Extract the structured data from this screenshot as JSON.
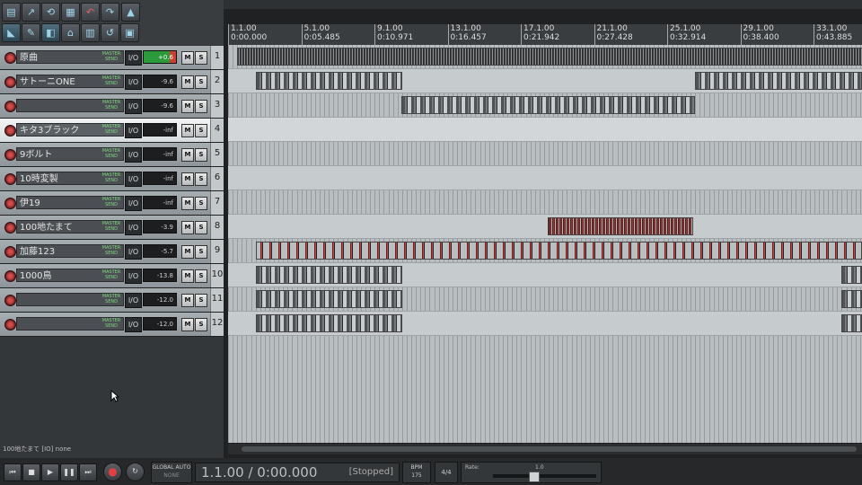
{
  "ruler": {
    "markers": [
      {
        "bar": "1.1.00",
        "time": "0:00.000"
      },
      {
        "bar": "5.1.00",
        "time": "0:05.485"
      },
      {
        "bar": "9.1.00",
        "time": "0:10.971"
      },
      {
        "bar": "13.1.00",
        "time": "0:16.457"
      },
      {
        "bar": "17.1.00",
        "time": "0:21.942"
      },
      {
        "bar": "21.1.00",
        "time": "0:27.428"
      },
      {
        "bar": "25.1.00",
        "time": "0:32.914"
      },
      {
        "bar": "29.1.00",
        "time": "0:38.400"
      },
      {
        "bar": "33.1.00",
        "time": "0:43.885"
      }
    ]
  },
  "tracks": [
    {
      "num": "1",
      "name": "原曲",
      "volume": "+0.6",
      "io": "I/O",
      "m": "M",
      "s": "S",
      "send": "MASTER SEND"
    },
    {
      "num": "2",
      "name": "サトーニONE",
      "volume": "-9.6",
      "io": "I/O",
      "m": "M",
      "s": "S",
      "send": "MASTER SEND"
    },
    {
      "num": "3",
      "name": "",
      "volume": "-9.6",
      "io": "I/O",
      "m": "M",
      "s": "S",
      "send": "MASTER SEND"
    },
    {
      "num": "4",
      "name": "キタ3ブラック",
      "volume": "-inf",
      "io": "I/O",
      "m": "M",
      "s": "S",
      "send": "MASTER SEND"
    },
    {
      "num": "5",
      "name": "9ボルト",
      "volume": "-inf",
      "io": "I/O",
      "m": "M",
      "s": "S",
      "send": "MASTER SEND"
    },
    {
      "num": "6",
      "name": "10時変製",
      "volume": "-inf",
      "io": "I/O",
      "m": "M",
      "s": "S",
      "send": "MASTER SEND"
    },
    {
      "num": "7",
      "name": "伊19",
      "volume": "-inf",
      "io": "I/O",
      "m": "M",
      "s": "S",
      "send": "MASTER SEND"
    },
    {
      "num": "8",
      "name": "100地たまて",
      "volume": "-3.9",
      "io": "I/O",
      "m": "M",
      "s": "S",
      "send": "MASTER SEND"
    },
    {
      "num": "9",
      "name": "加藤123",
      "volume": "-5.7",
      "io": "I/O",
      "m": "M",
      "s": "S",
      "send": "MASTER SEND"
    },
    {
      "num": "10",
      "name": "1000鳥",
      "volume": "-13.8",
      "io": "I/O",
      "m": "M",
      "s": "S",
      "send": "MASTER SEND"
    },
    {
      "num": "11",
      "name": "",
      "volume": "-12.0",
      "io": "I/O",
      "m": "M",
      "s": "S",
      "send": "MASTER SEND"
    },
    {
      "num": "12",
      "name": "",
      "volume": "-12.0",
      "io": "I/O",
      "m": "M",
      "s": "S",
      "send": "MASTER SEND"
    }
  ],
  "status_line": "100地たまて [IO] none",
  "transport": {
    "position": "1.1.00 / 0:00.000",
    "state": "[Stopped]",
    "global_auto": "GLOBAL AUTO",
    "global_auto_mode": "NONE",
    "bpm_label": "BPM",
    "bpm_value": "175",
    "time_signature": "4/4",
    "rate_label": "Rate:",
    "rate_value": "1.0"
  },
  "colors": {
    "selected_track": "#eef0f1",
    "record_red": "#d14a4a",
    "meter_green": "#2a9a3a"
  }
}
